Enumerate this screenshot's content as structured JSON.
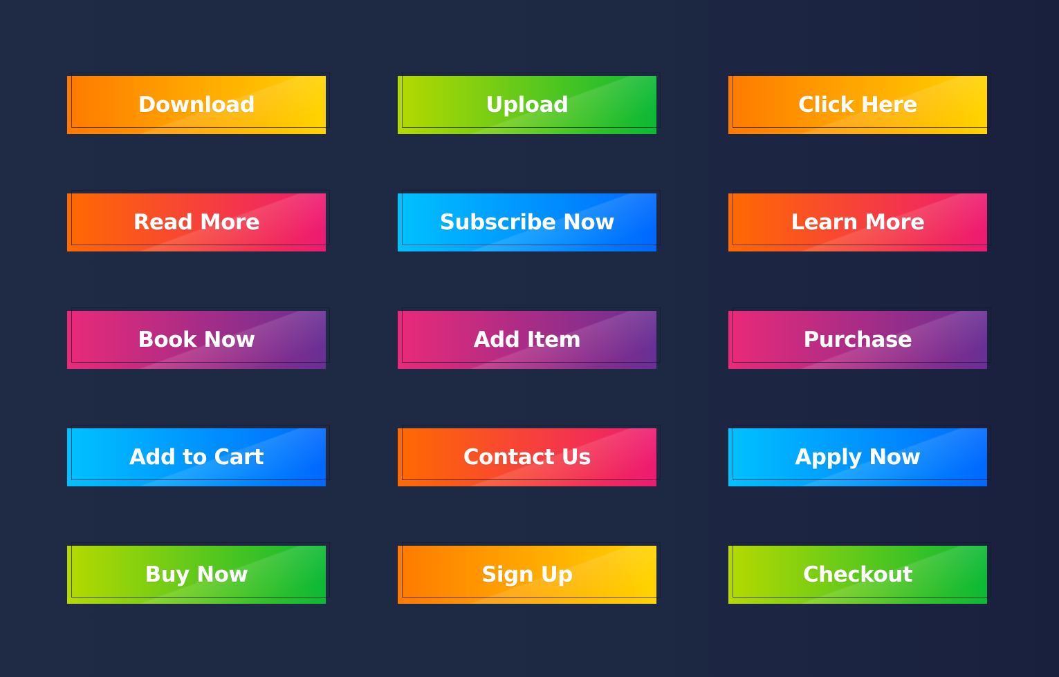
{
  "gradients": {
    "orange-yellow": [
      "#ff7a00",
      "#ffd400"
    ],
    "lime-green": [
      "#b6d900",
      "#0bb935"
    ],
    "orange-pink": [
      "#ff6a00",
      "#ee1a72"
    ],
    "cyan-blue": [
      "#00c2ff",
      "#0068ff"
    ],
    "pink-purple": [
      "#ea2a78",
      "#682f94"
    ]
  },
  "buttons": [
    {
      "label": "Download",
      "gradient": "orange-yellow"
    },
    {
      "label": "Upload",
      "gradient": "lime-green"
    },
    {
      "label": "Click Here",
      "gradient": "orange-yellow"
    },
    {
      "label": "Read More",
      "gradient": "orange-pink"
    },
    {
      "label": "Subscribe Now",
      "gradient": "cyan-blue"
    },
    {
      "label": "Learn More",
      "gradient": "orange-pink"
    },
    {
      "label": "Book Now",
      "gradient": "pink-purple"
    },
    {
      "label": "Add Item",
      "gradient": "pink-purple"
    },
    {
      "label": "Purchase",
      "gradient": "pink-purple"
    },
    {
      "label": "Add to Cart",
      "gradient": "cyan-blue"
    },
    {
      "label": "Contact Us",
      "gradient": "orange-pink"
    },
    {
      "label": "Apply Now",
      "gradient": "cyan-blue"
    },
    {
      "label": "Buy Now",
      "gradient": "lime-green"
    },
    {
      "label": "Sign Up",
      "gradient": "orange-yellow"
    },
    {
      "label": "Checkout",
      "gradient": "lime-green"
    }
  ]
}
